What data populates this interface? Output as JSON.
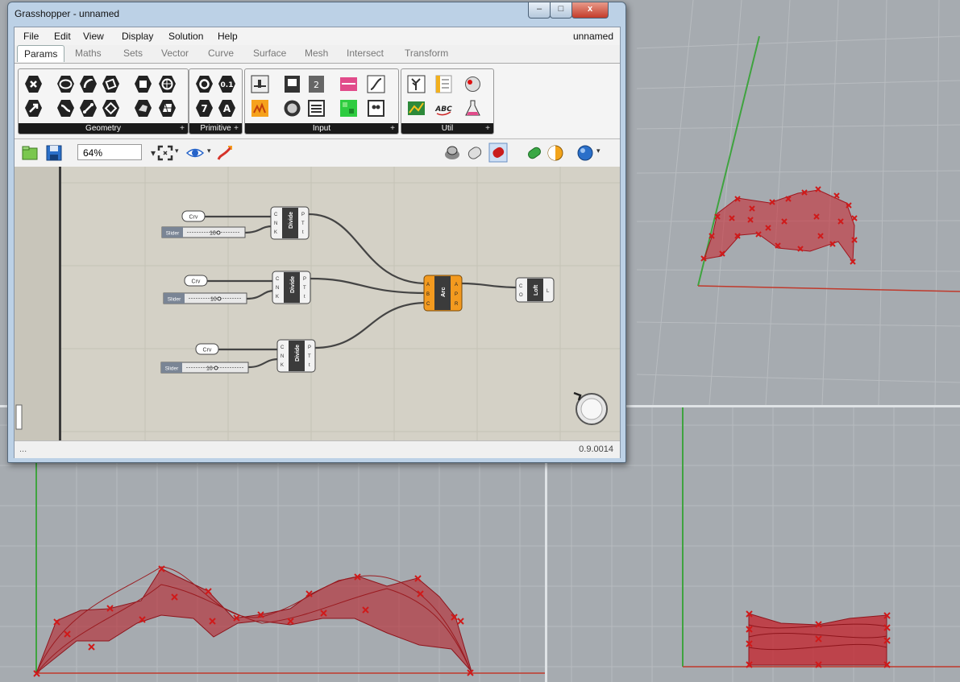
{
  "window": {
    "title": "Grasshopper - unnamed",
    "buttons": {
      "minimize": "–",
      "maximize": "□",
      "close": "x"
    }
  },
  "menu": {
    "items": [
      "File",
      "Edit",
      "View",
      "Display",
      "Solution",
      "Help"
    ],
    "document_name": "unnamed"
  },
  "tabs": [
    "Params",
    "Maths",
    "Sets",
    "Vector",
    "Curve",
    "Surface",
    "Mesh",
    "Intersect",
    "Transform"
  ],
  "active_tab": "Params",
  "ribbon": {
    "panels": [
      "Geometry",
      "Primitive",
      "Input",
      "Util"
    ]
  },
  "toolbar": {
    "zoom": "64%"
  },
  "canvas": {
    "crv_label": "Crv",
    "slider_label": "Slider",
    "slider_value": "10",
    "divide_label": "Divide",
    "divide_inputs": [
      "C",
      "N",
      "K"
    ],
    "divide_outputs": [
      "P",
      "T",
      "t"
    ],
    "arc_label": "Arc",
    "arc_inputs": [
      "A",
      "B",
      "C"
    ],
    "arc_outputs": [
      "A",
      "P",
      "R"
    ],
    "loft_label": "Loft",
    "loft_inputs": [
      "C",
      "O"
    ],
    "loft_outputs": [
      "L"
    ]
  },
  "status": {
    "left": "...",
    "version": "0.9.0014"
  },
  "colors": {
    "viewport_bg": "#a6abb0",
    "grid": "#b9bdc1",
    "x_axis": "#c0392b",
    "y_axis": "#3fa33f",
    "surface": "#c8202a",
    "arc_component": "#f39a1f",
    "canvas_bg": "#d4d1c6"
  },
  "icons": [
    "open-file-icon",
    "save-icon",
    "zoom-extents-icon",
    "preview-eye-icon",
    "sketch-icon",
    "preview-wire-icon",
    "preview-shaded-icon",
    "preview-selected-icon",
    "document-preview-icon",
    "material-icon",
    "navigator-compass-icon"
  ]
}
